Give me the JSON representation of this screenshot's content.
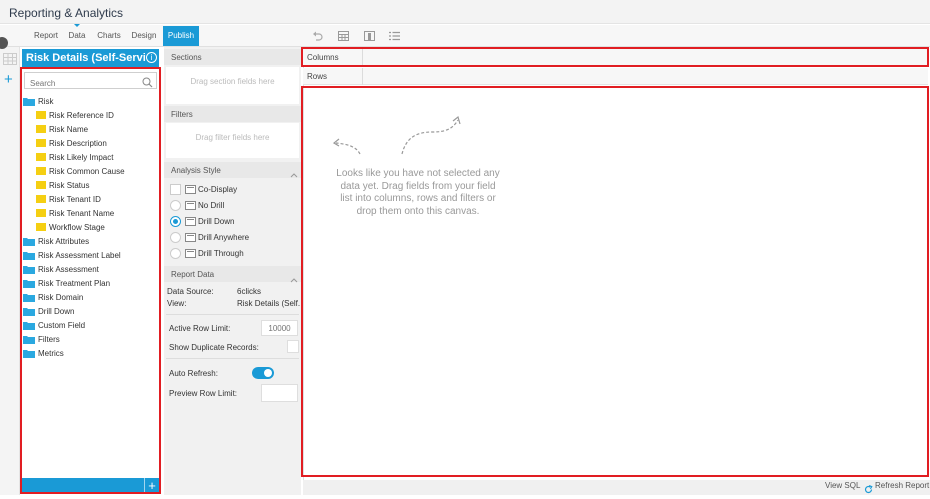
{
  "app": {
    "title": "Reporting & Analytics"
  },
  "nav": {
    "tabs": [
      {
        "label": "Report"
      },
      {
        "label": "Data"
      },
      {
        "label": "Charts"
      },
      {
        "label": "Design"
      },
      {
        "label": "Publish",
        "active": true
      }
    ]
  },
  "toolbar": {
    "icons": [
      "undo-icon",
      "table-icon",
      "column-layout-icon",
      "list-icon"
    ]
  },
  "field_panel": {
    "title": "Risk Details (Self-Servi...",
    "search_placeholder": "Search",
    "tree": {
      "root": "Risk",
      "fields": [
        "Risk Reference ID",
        "Risk Name",
        "Risk Description",
        "Risk Likely Impact",
        "Risk Common Cause",
        "Risk Status",
        "Risk Tenant ID",
        "Risk Tenant Name",
        "Workflow Stage"
      ],
      "folders": [
        "Risk Attributes",
        "Risk Assessment Label",
        "Risk Assessment",
        "Risk Treatment Plan",
        "Risk Domain",
        "Drill Down",
        "Custom Field",
        "Filters",
        "Metrics"
      ]
    },
    "add_label": "+"
  },
  "sections": {
    "title": "Sections",
    "placeholder": "Drag section fields here"
  },
  "filters": {
    "title": "Filters",
    "placeholder": "Drag filter fields here"
  },
  "analysis_style": {
    "title": "Analysis Style",
    "options": [
      {
        "label": "Co-Display",
        "control": "checkbox"
      },
      {
        "label": "No Drill",
        "control": "radio"
      },
      {
        "label": "Drill Down",
        "control": "radio",
        "selected": true
      },
      {
        "label": "Drill Anywhere",
        "control": "radio"
      },
      {
        "label": "Drill Through",
        "control": "radio"
      }
    ]
  },
  "report_data": {
    "title": "Report Data",
    "data_source_label": "Data Source:",
    "data_source_value": "6clicks",
    "view_label": "View:",
    "view_value": "Risk Details (Self...",
    "active_row_limit_label": "Active Row Limit:",
    "active_row_limit_placeholder": "10000",
    "show_duplicates_label": "Show Duplicate Records:",
    "auto_refresh_label": "Auto Refresh:",
    "auto_refresh_on": true,
    "preview_row_limit_label": "Preview Row Limit:"
  },
  "canvas": {
    "columns_label": "Columns",
    "rows_label": "Rows",
    "empty_message": "Looks like you have not selected any data yet. Drag fields from your field list into columns, rows and filters or drop them onto this canvas."
  },
  "footer": {
    "view_sql": "View SQL",
    "refresh_report": "Refresh Report"
  },
  "colors": {
    "accent": "#1a9ad6",
    "highlight": "#e11d22",
    "field": "#f5cf12",
    "folder": "#2aa8e0"
  }
}
